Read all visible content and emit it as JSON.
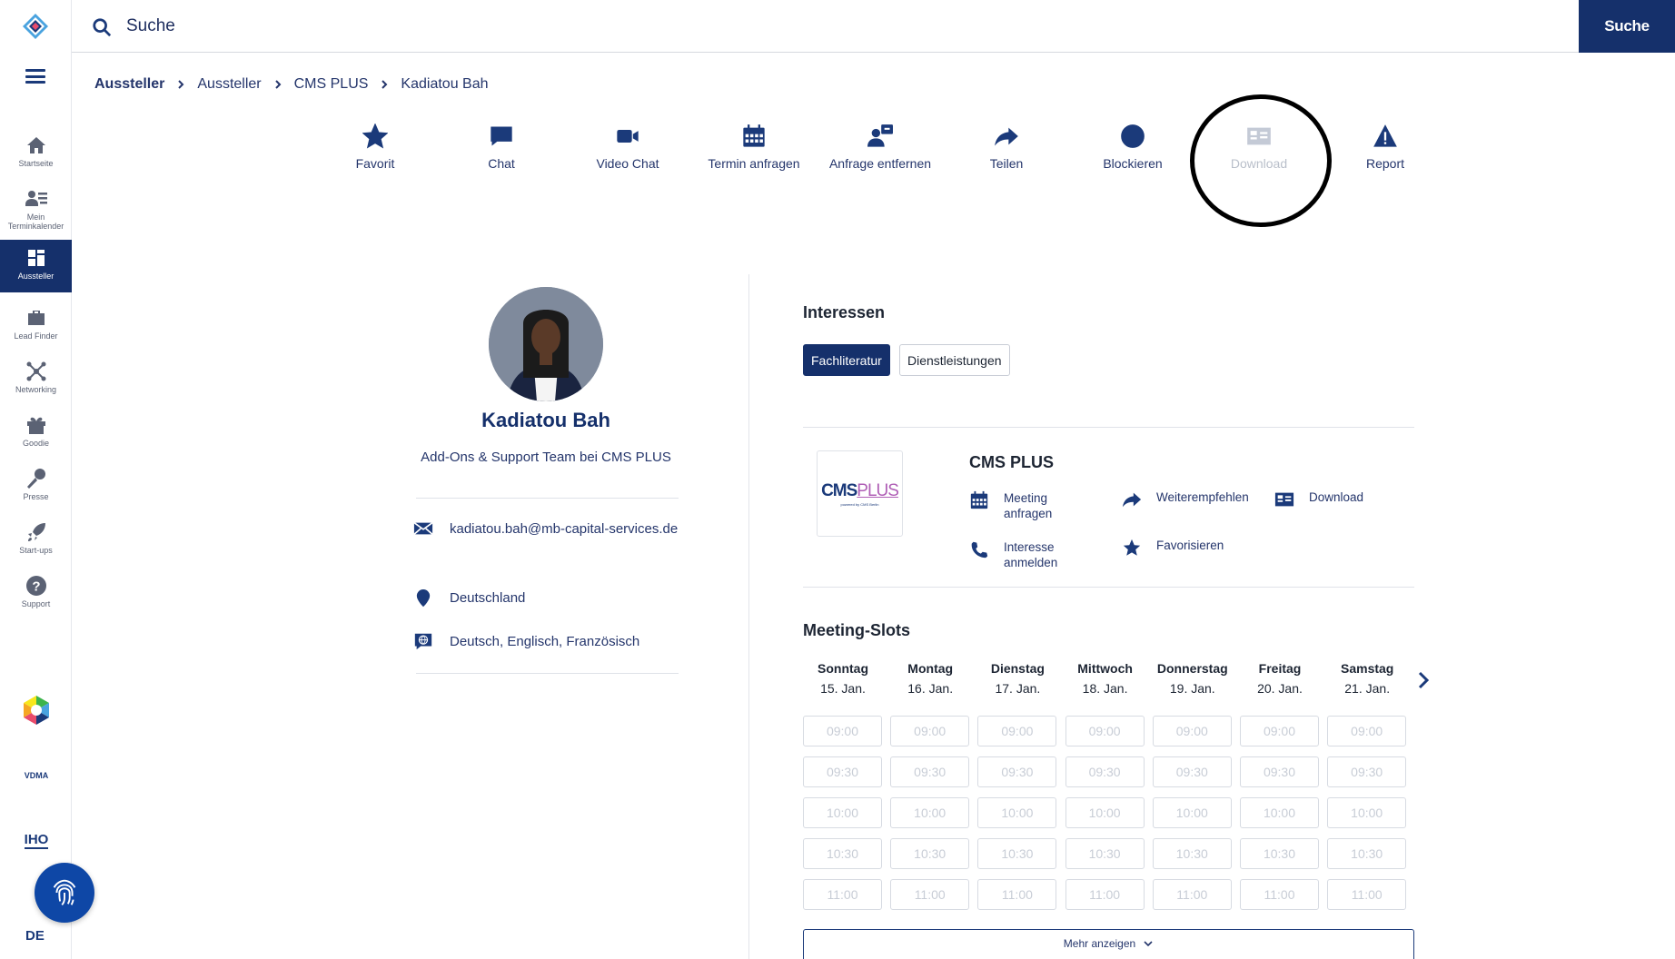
{
  "search": {
    "placeholder": "Suche",
    "button": "Suche"
  },
  "sidebar": {
    "items": [
      {
        "label": "Startseite",
        "icon": "home-icon"
      },
      {
        "label": "Mein Terminkalender",
        "icon": "calendar-user-icon"
      },
      {
        "label": "Aussteller",
        "icon": "exhibitor-icon"
      },
      {
        "label": "Lead Finder",
        "icon": "briefcase-icon"
      },
      {
        "label": "Networking",
        "icon": "network-icon"
      },
      {
        "label": "Goodie",
        "icon": "gift-icon"
      },
      {
        "label": "Presse",
        "icon": "microphone-icon"
      },
      {
        "label": "Start-ups",
        "icon": "rocket-icon"
      },
      {
        "label": "Support",
        "icon": "question-icon"
      }
    ],
    "partner_logos": [
      "VDMA",
      "IHO"
    ],
    "language": "DE"
  },
  "breadcrumb": [
    "Aussteller",
    "Aussteller",
    "CMS PLUS",
    "Kadiatou Bah"
  ],
  "actions": [
    {
      "label": "Favorit",
      "icon": "star-icon"
    },
    {
      "label": "Chat",
      "icon": "chat-icon"
    },
    {
      "label": "Video Chat",
      "icon": "video-icon"
    },
    {
      "label": "Termin anfragen",
      "icon": "calendar-icon"
    },
    {
      "label": "Anfrage entfernen",
      "icon": "remove-request-icon"
    },
    {
      "label": "Teilen",
      "icon": "share-icon"
    },
    {
      "label": "Blockieren",
      "icon": "block-icon"
    },
    {
      "label": "Download",
      "icon": "id-card-icon",
      "disabled": true
    },
    {
      "label": "Report",
      "icon": "warning-icon"
    }
  ],
  "profile": {
    "name": "Kadiatou Bah",
    "role": "Add-Ons & Support Team bei CMS PLUS",
    "email": "kadiatou.bah@mb-capital-services.de",
    "country": "Deutschland",
    "languages": "Deutsch, Englisch, Französisch"
  },
  "interests": {
    "heading": "Interessen",
    "tags": [
      {
        "label": "Fachliteratur",
        "active": true
      },
      {
        "label": "Dienstleistungen",
        "active": false
      }
    ]
  },
  "company": {
    "name": "CMS PLUS",
    "logo_main": "CMS",
    "logo_plus": "PLUS",
    "logo_sub": "powered by CMS Berlin",
    "links": {
      "meeting": "Meeting anfragen",
      "interest": "Interesse anmelden",
      "recommend": "Weiterempfehlen",
      "favorite": "Favorisieren",
      "download": "Download"
    }
  },
  "meeting_slots": {
    "heading": "Meeting-Slots",
    "days": [
      {
        "name": "Sonntag",
        "date": "15. Jan."
      },
      {
        "name": "Montag",
        "date": "16. Jan."
      },
      {
        "name": "Dienstag",
        "date": "17. Jan."
      },
      {
        "name": "Mittwoch",
        "date": "18. Jan."
      },
      {
        "name": "Donnerstag",
        "date": "19. Jan."
      },
      {
        "name": "Freitag",
        "date": "20. Jan."
      },
      {
        "name": "Samstag",
        "date": "21. Jan."
      }
    ],
    "times": [
      "09:00",
      "09:30",
      "10:00",
      "10:30",
      "11:00"
    ],
    "more_label": "Mehr anzeigen"
  }
}
